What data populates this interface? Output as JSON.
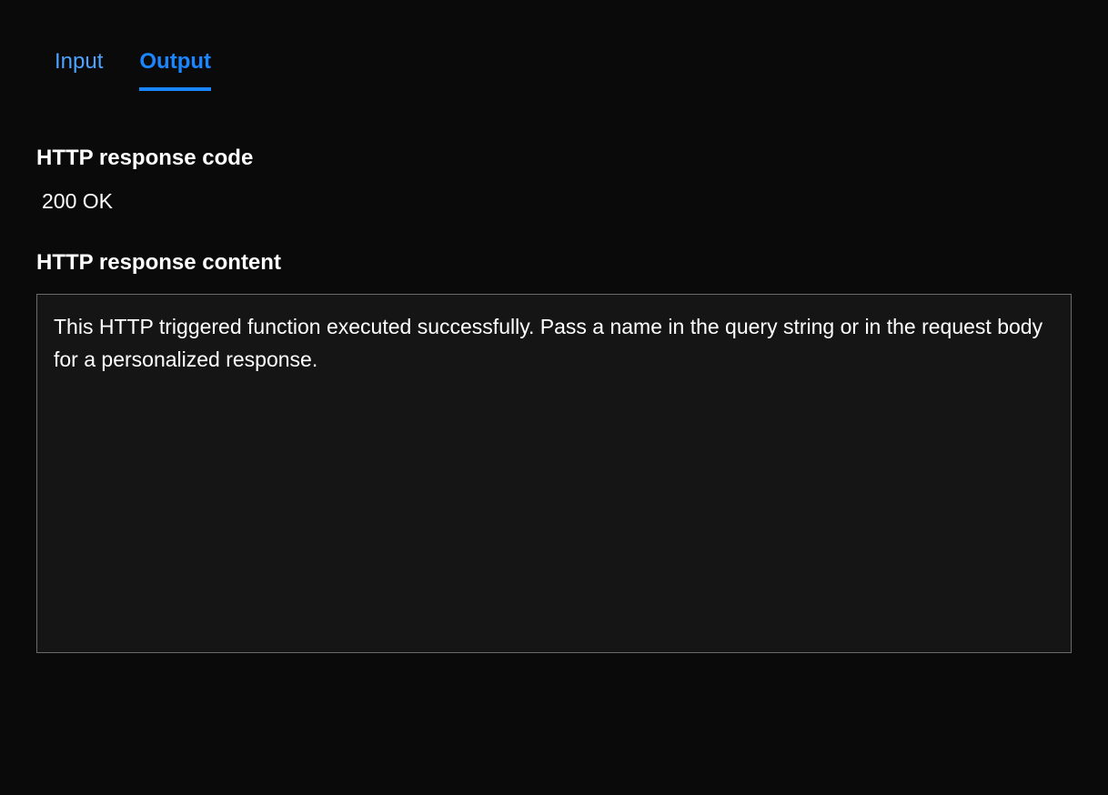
{
  "tabs": {
    "input": {
      "label": "Input",
      "active": false
    },
    "output": {
      "label": "Output",
      "active": true
    }
  },
  "response_code": {
    "label": "HTTP response code",
    "value": "200 OK"
  },
  "response_content": {
    "label": "HTTP response content",
    "body": "This HTTP triggered function executed successfully. Pass a name in the query string or in the request body for a personalized response."
  }
}
